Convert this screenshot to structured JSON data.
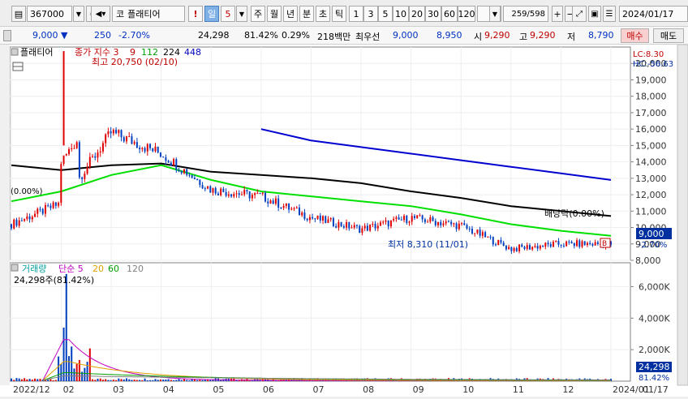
{
  "toolbar": {
    "code": "367000",
    "market_tag": "코",
    "stock_name": "플래티어",
    "alert_mark": "!",
    "period_label": "일",
    "period_value": "5",
    "buttons": [
      "주",
      "월",
      "년",
      "분",
      "초",
      "틱"
    ],
    "minutes": [
      "1",
      "3",
      "5",
      "10",
      "20",
      "30",
      "60",
      "120"
    ],
    "page_counter": "259/598",
    "date": "2024/01/17"
  },
  "quote": {
    "price": "9,000",
    "change_arrow": "▼",
    "change": "250",
    "change_pct": "-2.70%",
    "volume": "24,298",
    "volume_ratio": "81.42%",
    "turnover_ratio": "0.29%",
    "amount": "218백만",
    "bid_label": "최우선",
    "bid1": "9,000",
    "bid2": "8,950",
    "open_label": "시",
    "open": "9,290",
    "high_label": "고",
    "high": "9,290",
    "low_label": "저",
    "low": "8,790",
    "buy_label": "매수",
    "sell_label": "매도"
  },
  "price_panel": {
    "title": "플래티어",
    "legend": [
      {
        "text": "종가 지수 3",
        "color": "#c00000"
      },
      {
        "text": "9",
        "color": "#c00000"
      },
      {
        "text": "112",
        "color": "#00a000"
      },
      {
        "text": "224",
        "color": "#000000"
      },
      {
        "text": "448",
        "color": "#0000c0"
      }
    ],
    "max_note": "최고 20,750 (02/10)",
    "min_note": "최저 8,310 (11/01)",
    "dividend_note": "배당락(0.00%)",
    "left_note": "(0.00%)",
    "lc": "LC:8.30",
    "hc": "HC:-56.63",
    "price_tag": "9,000",
    "pct_tag": "-2.70%",
    "b_tag": "B",
    "y_ticks": [
      "20,000",
      "19,000",
      "18,000",
      "17,000",
      "16,000",
      "15,000",
      "14,000",
      "13,000",
      "12,000",
      "11,000",
      "10,000",
      "9,000",
      "8,000"
    ]
  },
  "volume_panel": {
    "legend_title": "거래량",
    "legend_items": [
      {
        "text": "단순 5",
        "color": "#c000c0"
      },
      {
        "text": "20",
        "color": "#e0a000"
      },
      {
        "text": "60",
        "color": "#00a000"
      },
      {
        "text": "120",
        "color": "#808080"
      }
    ],
    "info": "24,298주(81.42%)",
    "y_ticks": [
      "6,000K",
      "4,000K",
      "2,000K"
    ],
    "vol_tag": "24,298",
    "vol_pct_tag": "81.42%"
  },
  "x_axis": {
    "labels": [
      "2022/12",
      "02",
      "03",
      "04",
      "05",
      "06",
      "07",
      "08",
      "09",
      "10",
      "11",
      "12",
      "2024/01"
    ],
    "right_label": "01/17"
  },
  "colors": {
    "up": "#e00000",
    "down": "#0040c0",
    "ma112": "#00e000",
    "ma224": "#000000",
    "ma448": "#0000d0",
    "price_tag_bg": "#0030a0"
  },
  "chart_data": {
    "type": "line",
    "title": "",
    "x": [
      "2022/12",
      "02",
      "03",
      "04",
      "05",
      "06",
      "07",
      "08",
      "09",
      "10",
      "11",
      "12",
      "2024/01"
    ],
    "series": [
      {
        "name": "종가",
        "values": [
          10200,
          11500,
          15800,
          14500,
          12300,
          11900,
          10600,
          9900,
          10600,
          10100,
          8700,
          9000,
          9000
        ]
      },
      {
        "name": "112",
        "values": [
          11600,
          12200,
          13200,
          13800,
          12900,
          12200,
          11900,
          11600,
          11300,
          10800,
          10200,
          9800,
          9500
        ]
      },
      {
        "name": "224",
        "values": [
          13800,
          13500,
          13800,
          13900,
          13400,
          13200,
          13000,
          12700,
          12200,
          11800,
          11300,
          11000,
          10700
        ]
      },
      {
        "name": "448",
        "values": [
          null,
          null,
          null,
          null,
          null,
          16000,
          15300,
          14900,
          14500,
          14100,
          13700,
          13300,
          12900
        ]
      }
    ],
    "ylim": [
      8000,
      21000
    ],
    "max_point": {
      "value": 20750,
      "date": "02/10"
    },
    "min_point": {
      "value": 8310,
      "date": "11/01"
    },
    "volume_ylim": [
      0,
      7000000
    ]
  }
}
